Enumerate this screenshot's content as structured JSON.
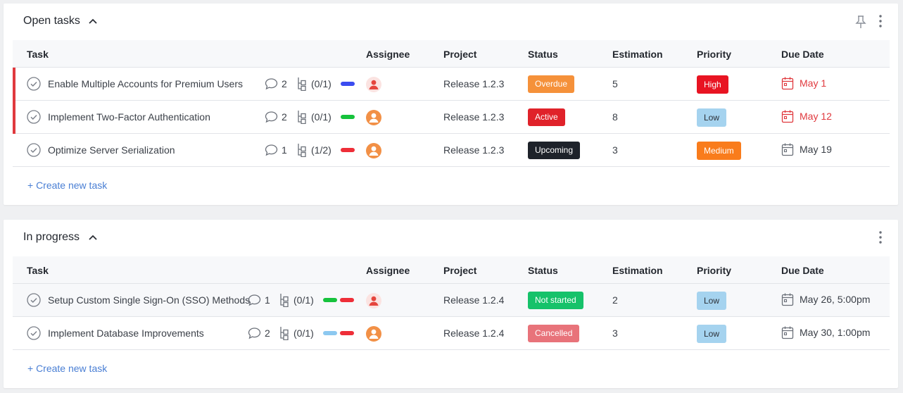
{
  "columns": {
    "task": "Task",
    "assignee": "Assignee",
    "project": "Project",
    "status": "Status",
    "estimation": "Estimation",
    "priority": "Priority",
    "due_date": "Due Date"
  },
  "colors": {
    "overdue": "#f5913a",
    "active": "#e0222a",
    "upcoming": "#1e222a",
    "not_started": "#16c26a",
    "cancelled": "#e8737a",
    "high": "#e81422",
    "low": "#a5d3ef",
    "medium": "#f97c1c",
    "overdue_date": "#e0393e",
    "link": "#4a7fd4"
  },
  "sections": [
    {
      "title": "Open tasks",
      "create_label": "+ Create new task",
      "tasks": [
        {
          "name": "Enable Multiple Accounts for Premium Users",
          "comments": "2",
          "subtasks": "(0/1)",
          "tags": [
            "#3b4cf0"
          ],
          "assignee_icon": "avatar-red-icon",
          "project": "Release 1.2.3",
          "status": "Overdue",
          "status_color": "#f5913a",
          "estimation": "5",
          "priority": "High",
          "priority_color": "#e81422",
          "priority_text": "#ffffff",
          "due": "May 1",
          "due_color": "#e0393e",
          "flagged": true
        },
        {
          "name": "Implement Two-Factor Authentication",
          "comments": "2",
          "subtasks": "(0/1)",
          "tags": [
            "#16c23c"
          ],
          "assignee_icon": "avatar-orange-icon",
          "project": "Release 1.2.3",
          "status": "Active",
          "status_color": "#e0222a",
          "estimation": "8",
          "priority": "Low",
          "priority_color": "#a5d3ef",
          "priority_text": "#2b2f36",
          "due": "May 12",
          "due_color": "#e0393e",
          "flagged": true
        },
        {
          "name": "Optimize Server Serialization",
          "comments": "1",
          "subtasks": "(1/2)",
          "tags": [
            "#ee2e38"
          ],
          "assignee_icon": "avatar-orange-icon",
          "project": "Release 1.2.3",
          "status": "Upcoming",
          "status_color": "#1e222a",
          "estimation": "3",
          "priority": "Medium",
          "priority_color": "#f97c1c",
          "priority_text": "#ffffff",
          "due": "May 19",
          "due_color": "#3a3f47",
          "flagged": false
        }
      ]
    },
    {
      "title": "In progress",
      "create_label": "+ Create new task",
      "tasks": [
        {
          "name": "Setup Custom Single Sign-On (SSO) Methods",
          "comments": "1",
          "subtasks": "(0/1)",
          "tags": [
            "#16c23c",
            "#ee2e38"
          ],
          "assignee_icon": "avatar-red-icon",
          "project": "Release 1.2.4",
          "status": "Not started",
          "status_color": "#16c26a",
          "estimation": "2",
          "priority": "Low",
          "priority_color": "#a5d3ef",
          "priority_text": "#2b2f36",
          "due": "May 26, 5:00pm",
          "due_color": "#3a3f47",
          "flagged": false
        },
        {
          "name": "Implement Database Improvements",
          "comments": "2",
          "subtasks": "(0/1)",
          "tags": [
            "#8cc8f0",
            "#ee2e38"
          ],
          "assignee_icon": "avatar-orange-icon",
          "project": "Release 1.2.4",
          "status": "Cancelled",
          "status_color": "#e8737a",
          "estimation": "3",
          "priority": "Low",
          "priority_color": "#a5d3ef",
          "priority_text": "#2b2f36",
          "due": "May 30, 1:00pm",
          "due_color": "#3a3f47",
          "flagged": false
        }
      ]
    }
  ]
}
